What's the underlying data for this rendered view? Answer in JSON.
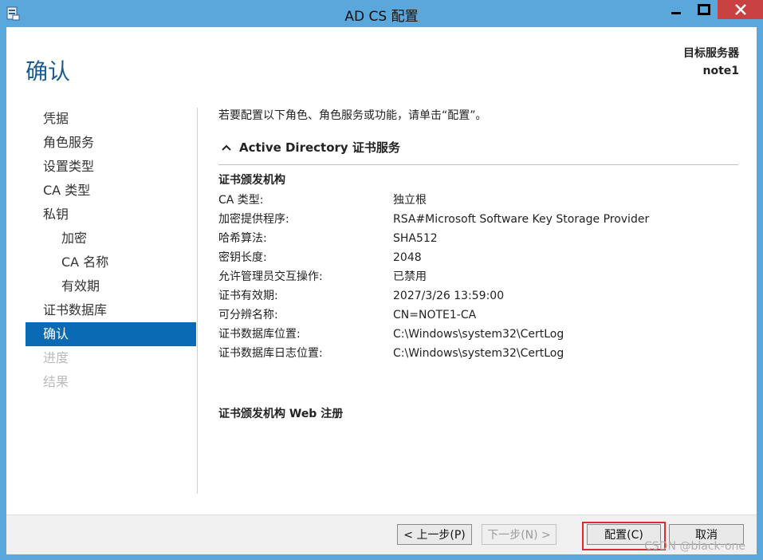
{
  "window": {
    "title": "AD CS 配置"
  },
  "header": {
    "page_title": "确认",
    "target_server_label": "目标服务器",
    "target_server_value": "note1"
  },
  "nav": {
    "items": [
      {
        "label": "凭据",
        "state": "normal",
        "indent": false
      },
      {
        "label": "角色服务",
        "state": "normal",
        "indent": false
      },
      {
        "label": "设置类型",
        "state": "normal",
        "indent": false
      },
      {
        "label": "CA 类型",
        "state": "normal",
        "indent": false
      },
      {
        "label": "私钥",
        "state": "normal",
        "indent": false
      },
      {
        "label": "加密",
        "state": "normal",
        "indent": true
      },
      {
        "label": "CA 名称",
        "state": "normal",
        "indent": true
      },
      {
        "label": "有效期",
        "state": "normal",
        "indent": true
      },
      {
        "label": "证书数据库",
        "state": "normal",
        "indent": false
      },
      {
        "label": "确认",
        "state": "active",
        "indent": false
      },
      {
        "label": "进度",
        "state": "disabled",
        "indent": false
      },
      {
        "label": "结果",
        "state": "disabled",
        "indent": false
      }
    ]
  },
  "content": {
    "intro": "若要配置以下角色、角色服务或功能，请单击“配置”。",
    "section_title": "Active Directory 证书服务",
    "group1_title": "证书颁发机构",
    "rows": [
      {
        "k": "CA 类型:",
        "v": "独立根"
      },
      {
        "k": "加密提供程序:",
        "v": "RSA#Microsoft Software Key Storage Provider"
      },
      {
        "k": "哈希算法:",
        "v": "SHA512"
      },
      {
        "k": "密钥长度:",
        "v": "2048"
      },
      {
        "k": "允许管理员交互操作:",
        "v": "已禁用"
      },
      {
        "k": "证书有效期:",
        "v": "2027/3/26 13:59:00"
      },
      {
        "k": "可分辨名称:",
        "v": "CN=NOTE1-CA"
      },
      {
        "k": "证书数据库位置:",
        "v": "C:\\Windows\\system32\\CertLog"
      },
      {
        "k": "证书数据库日志位置:",
        "v": "C:\\Windows\\system32\\CertLog"
      }
    ],
    "group2_title": "证书颁发机构 Web 注册"
  },
  "buttons": {
    "prev": "< 上一步(P)",
    "next": "下一步(N) >",
    "configure": "配置(C)",
    "cancel": "取消"
  },
  "watermark": "CSDN @black-one",
  "colors": {
    "accent": "#0a6ab4",
    "frame": "#5aa7dc",
    "close": "#c94040",
    "highlight": "#e02b2b"
  }
}
